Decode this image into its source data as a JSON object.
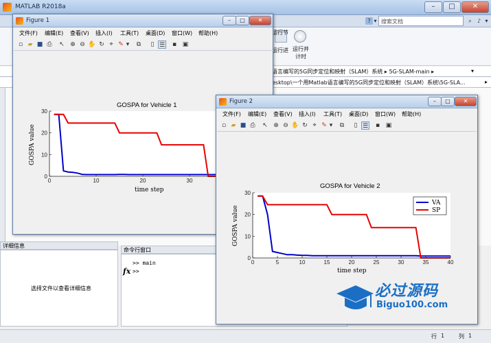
{
  "main": {
    "title": "MATLAB R2018a",
    "search_placeholder": "搜索文档",
    "ribbon": {
      "run_section": "运行节",
      "back": "运行进",
      "run_time": "运行并\n计时"
    },
    "address1": "语言编写的5G同步定位和映射（SLAM）系统 ▸ 5G-SLAM-main ▸",
    "address2": "esktop\\一个用Matlab语言编写的5G同步定位和映射（SLAM）系统\\5G-SLA...",
    "details_header": "详细信息",
    "details_text": "选择文件以查看详细信息",
    "cmd_header": "命令行窗口",
    "cmd_line1": ">> main",
    "cmd_line2": ">>",
    "status_row_label": "行",
    "status_row": "1",
    "status_col_label": "列",
    "status_col": "1"
  },
  "figure_menu": [
    "文件(F)",
    "编辑(E)",
    "查看(V)",
    "插入(I)",
    "工具(T)",
    "桌面(D)",
    "窗口(W)",
    "帮助(H)"
  ],
  "fig1": {
    "title": "Figure 1"
  },
  "fig2": {
    "title": "Figure 2"
  },
  "colors": {
    "va": "#0000cc",
    "sp": "#e60000"
  },
  "chart_data": [
    {
      "type": "line",
      "title": "GOSPA for Vehicle 1",
      "xlabel": "time step",
      "ylabel": "GOSPA value",
      "xlim": [
        0,
        40
      ],
      "ylim": [
        0,
        30
      ],
      "xticks": [
        0,
        10,
        20,
        30
      ],
      "yticks": [
        0,
        10,
        20,
        30
      ],
      "legend": "top-right",
      "series": [
        {
          "x": [
            1,
            2,
            3,
            4,
            5,
            6,
            7,
            8,
            9,
            10,
            11,
            12,
            13,
            14,
            15,
            16,
            17,
            18,
            19,
            20,
            21,
            22,
            23,
            24,
            25,
            26,
            27,
            28,
            29,
            30,
            31,
            32,
            33,
            34,
            35,
            36,
            37,
            38,
            39,
            40
          ],
          "y": [
            28.5,
            28.5,
            2.5,
            2,
            1.8,
            1.5,
            0.9,
            0.8,
            0.8,
            0.8,
            0.8,
            0.8,
            0.8,
            0.8,
            0.9,
            0.9,
            0.8,
            0.8,
            0.8,
            0.8,
            0.8,
            0.8,
            0.8,
            0.8,
            0.8,
            0.8,
            0.8,
            0.8,
            0.8,
            0.8,
            0.8,
            0.8,
            0.8,
            0.8,
            0.8,
            0.8,
            0.8,
            0.8,
            0.8,
            0.8
          ]
        },
        {
          "x": [
            1,
            2,
            3,
            4,
            5,
            6,
            7,
            8,
            9,
            10,
            11,
            12,
            13,
            14,
            15,
            16,
            17,
            18,
            19,
            20,
            21,
            22,
            23,
            24,
            25,
            26,
            27,
            28,
            29,
            30,
            31,
            32,
            33,
            34,
            35,
            36,
            37,
            38,
            39,
            40
          ],
          "y": [
            28.5,
            28.5,
            28.5,
            24.5,
            24.5,
            24.5,
            24.5,
            24.5,
            24.5,
            24.5,
            24.5,
            24.5,
            24.5,
            24.5,
            20,
            20,
            20,
            20,
            20,
            20,
            20,
            20,
            20,
            14.5,
            14.5,
            14.5,
            14.5,
            14.5,
            14.5,
            14.5,
            14.5,
            14.5,
            14.5,
            0,
            0,
            0,
            0,
            0,
            0,
            0
          ]
        }
      ]
    },
    {
      "type": "line",
      "title": "GOSPA for Vehicle 2",
      "xlabel": "time step",
      "ylabel": "GOSPA value",
      "xlim": [
        0,
        40
      ],
      "ylim": [
        0,
        30
      ],
      "xticks": [
        0,
        5,
        10,
        15,
        20,
        25,
        30,
        35,
        40
      ],
      "yticks": [
        0,
        10,
        20,
        30
      ],
      "legend": "top-right",
      "series": [
        {
          "name": "VA",
          "x": [
            1,
            2,
            3,
            4,
            5,
            6,
            7,
            8,
            9,
            10,
            11,
            12,
            13,
            14,
            15,
            16,
            17,
            18,
            19,
            20,
            21,
            22,
            23,
            24,
            25,
            26,
            27,
            28,
            29,
            30,
            31,
            32,
            33,
            34,
            35,
            36,
            37,
            38,
            39,
            40
          ],
          "y": [
            28.5,
            28.5,
            20,
            3,
            2.5,
            2,
            1.5,
            1.5,
            1.3,
            1.2,
            1.2,
            1,
            1,
            1,
            1,
            1,
            1,
            1,
            1,
            1,
            1,
            1,
            1,
            1,
            1,
            1,
            1,
            1,
            1,
            1,
            1,
            1,
            1,
            0.9,
            0.9,
            0.9,
            0.9,
            0.9,
            0.9,
            0.9
          ]
        },
        {
          "name": "SP",
          "x": [
            1,
            2,
            3,
            4,
            5,
            6,
            7,
            8,
            9,
            10,
            11,
            12,
            13,
            14,
            15,
            16,
            17,
            18,
            19,
            20,
            21,
            22,
            23,
            24,
            25,
            26,
            27,
            28,
            29,
            30,
            31,
            32,
            33,
            34,
            35,
            36,
            37,
            38,
            39,
            40
          ],
          "y": [
            28.5,
            28.5,
            24.5,
            24.5,
            24.5,
            24.5,
            24.5,
            24.5,
            24.5,
            24.5,
            24.5,
            24.5,
            24.5,
            24.5,
            24.5,
            20,
            20,
            20,
            20,
            20,
            20,
            20,
            20,
            14,
            14,
            14,
            14,
            14,
            14,
            14,
            14,
            14,
            14,
            0,
            0,
            0,
            0,
            0,
            0,
            0
          ]
        }
      ]
    }
  ],
  "watermark": {
    "cn": "必过源码",
    "en": "Biguo100.com"
  }
}
